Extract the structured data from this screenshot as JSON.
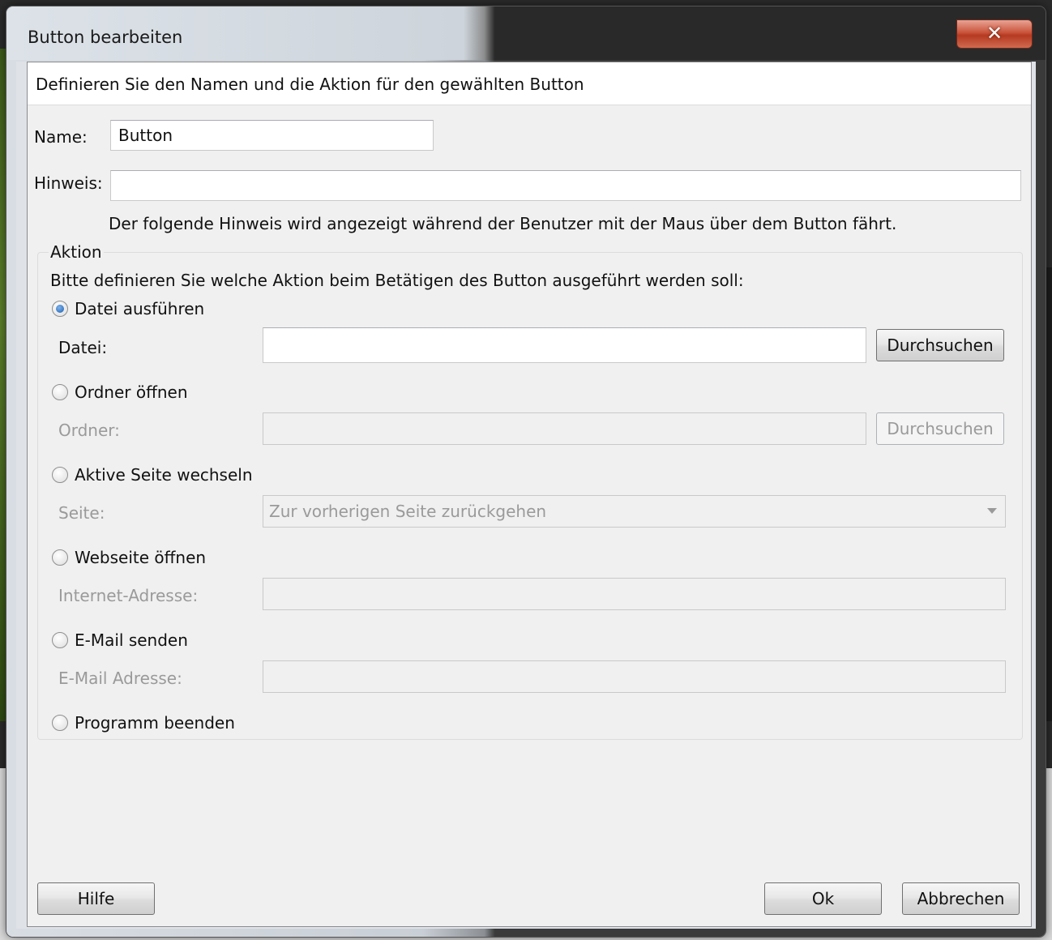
{
  "window": {
    "title": "Button bearbeiten",
    "close_glyph": "✕"
  },
  "header": {
    "text": "Definieren Sie den Namen und die Aktion für den gewählten Button"
  },
  "form": {
    "name_label": "Name:",
    "name_value": "Button",
    "hint_label": "Hinweis:",
    "hint_value": "",
    "hint_help": "Der folgende Hinweis wird angezeigt während der Benutzer mit der Maus über dem Button fährt."
  },
  "action": {
    "group_title": "Aktion",
    "instruction": "Bitte definieren Sie welche Aktion beim Betätigen des Button ausgeführt werden soll:",
    "options": [
      {
        "label": "Datei ausführen",
        "selected": true
      },
      {
        "label": "Ordner öffnen",
        "selected": false
      },
      {
        "label": "Aktive Seite wechseln",
        "selected": false
      },
      {
        "label": "Webseite öffnen",
        "selected": false
      },
      {
        "label": "E-Mail senden",
        "selected": false
      },
      {
        "label": "Programm beenden",
        "selected": false
      }
    ],
    "file_label": "Datei:",
    "file_value": "",
    "file_browse": "Durchsuchen",
    "folder_label": "Ordner:",
    "folder_value": "",
    "folder_browse": "Durchsuchen",
    "page_label": "Seite:",
    "page_selected": "Zur vorherigen Seite zurückgehen",
    "url_label": "Internet-Adresse:",
    "url_value": "",
    "email_label": "E-Mail Adresse:",
    "email_value": ""
  },
  "footer": {
    "help": "Hilfe",
    "ok": "Ok",
    "cancel": "Abbrechen"
  }
}
